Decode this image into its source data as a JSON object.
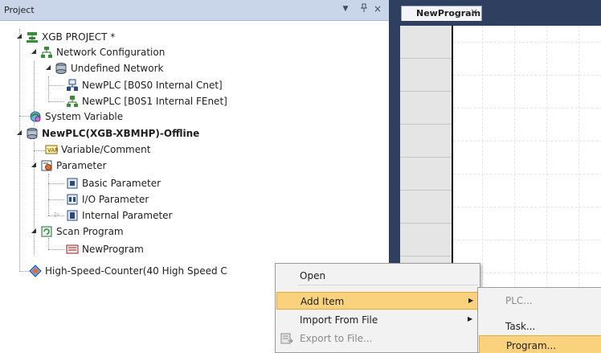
{
  "panel": {
    "title": "Project",
    "dropdown_glyph": "▼",
    "pin_glyph": "ꟷ",
    "close_glyph": "×"
  },
  "tree": {
    "project": "XGB PROJECT *",
    "network_configuration": "Network Configuration",
    "undefined_network": "Undefined Network",
    "plc_cnet": "NewPLC [B0S0 Internal Cnet]",
    "plc_fenet": "NewPLC [B0S1 Internal FEnet]",
    "system_variable": "System Variable",
    "plc": "NewPLC(XGB-XBMHP)-Offline",
    "variable_comment": "Variable/Comment",
    "parameter": "Parameter",
    "basic_parameter": "Basic Parameter",
    "io_parameter": "I/O Parameter",
    "internal_parameter": "Internal Parameter",
    "scan_program": "Scan Program",
    "new_program": "NewProgram",
    "hsc": "High-Speed-Counter(40 High Speed C"
  },
  "editor": {
    "tab_label": "NewProgram",
    "tab_close": "×"
  },
  "context_menu": {
    "open": "Open",
    "add_item": "Add Item",
    "import_from_file": "Import From File",
    "export_to_file": "Export to File...",
    "submenu_arrow": "▶"
  },
  "submenu": {
    "plc": "PLC...",
    "task": "Task...",
    "program": "Program..."
  },
  "colors": {
    "panel_header": "#c9d6e9",
    "editor_frame": "#2e3f5f",
    "menu_highlight": "#fad27e",
    "menu_highlight_border": "#e5a93b"
  }
}
